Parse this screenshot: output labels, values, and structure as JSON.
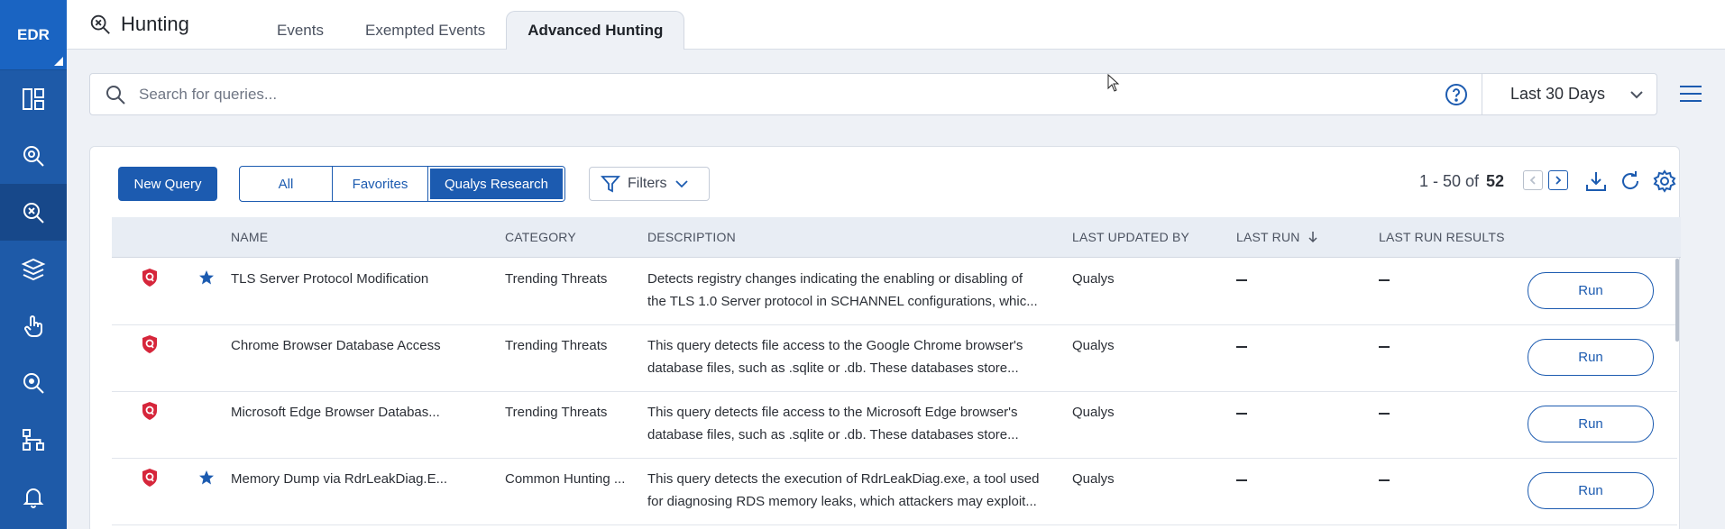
{
  "rail": {
    "logo": "EDR",
    "items": [
      {
        "icon": "dashboard-icon"
      },
      {
        "icon": "investigate-icon"
      },
      {
        "icon": "hunting-icon",
        "active": true
      },
      {
        "icon": "assets-icon"
      },
      {
        "icon": "response-icon"
      },
      {
        "icon": "threat-search-icon"
      },
      {
        "icon": "hierarchy-icon"
      },
      {
        "icon": "bell-icon"
      }
    ]
  },
  "header": {
    "title": "Hunting",
    "tabs": [
      {
        "label": "Events"
      },
      {
        "label": "Exempted Events"
      },
      {
        "label": "Advanced Hunting",
        "active": true
      }
    ]
  },
  "search": {
    "placeholder": "Search for queries...",
    "value": "",
    "date_range": "Last 30 Days"
  },
  "toolbar": {
    "new_query": "New Query",
    "segments": [
      {
        "label": "All"
      },
      {
        "label": "Favorites"
      },
      {
        "label": "Qualys Research",
        "active": true
      }
    ],
    "filters": "Filters",
    "pager_range": "1 - 50 of",
    "pager_total": "52"
  },
  "table": {
    "columns": [
      "NAME",
      "CATEGORY",
      "DESCRIPTION",
      "LAST UPDATED BY",
      "LAST RUN",
      "LAST RUN RESULTS"
    ],
    "run_label": "Run",
    "rows": [
      {
        "favorite": true,
        "name": "TLS Server Protocol Modification",
        "category": "Trending Threats",
        "desc1": "Detects registry changes indicating the enabling or disabling of",
        "desc2": "the TLS 1.0 Server protocol in SCHANNEL configurations, whic...",
        "updated_by": "Qualys"
      },
      {
        "favorite": false,
        "name": "Chrome Browser Database Access",
        "category": "Trending Threats",
        "desc1": "This query detects file access to the Google Chrome browser's",
        "desc2": "database files, such as .sqlite or .db. These databases store...",
        "updated_by": "Qualys"
      },
      {
        "favorite": false,
        "name": "Microsoft Edge Browser Databas...",
        "category": "Trending Threats",
        "desc1": "This query detects file access to the Microsoft Edge browser's",
        "desc2": "database files, such as .sqlite or .db. These databases store...",
        "updated_by": "Qualys"
      },
      {
        "favorite": true,
        "name": "Memory Dump via RdrLeakDiag.E...",
        "category": "Common Hunting ...",
        "desc1": "This query detects the execution of RdrLeakDiag.exe, a tool used",
        "desc2": "for diagnosing RDS memory leaks, which attackers may exploit...",
        "updated_by": "Qualys"
      }
    ]
  },
  "colors": {
    "rail": "#1e5aa8",
    "accent": "#1c5bb0",
    "query_icon": "#d6263b"
  }
}
